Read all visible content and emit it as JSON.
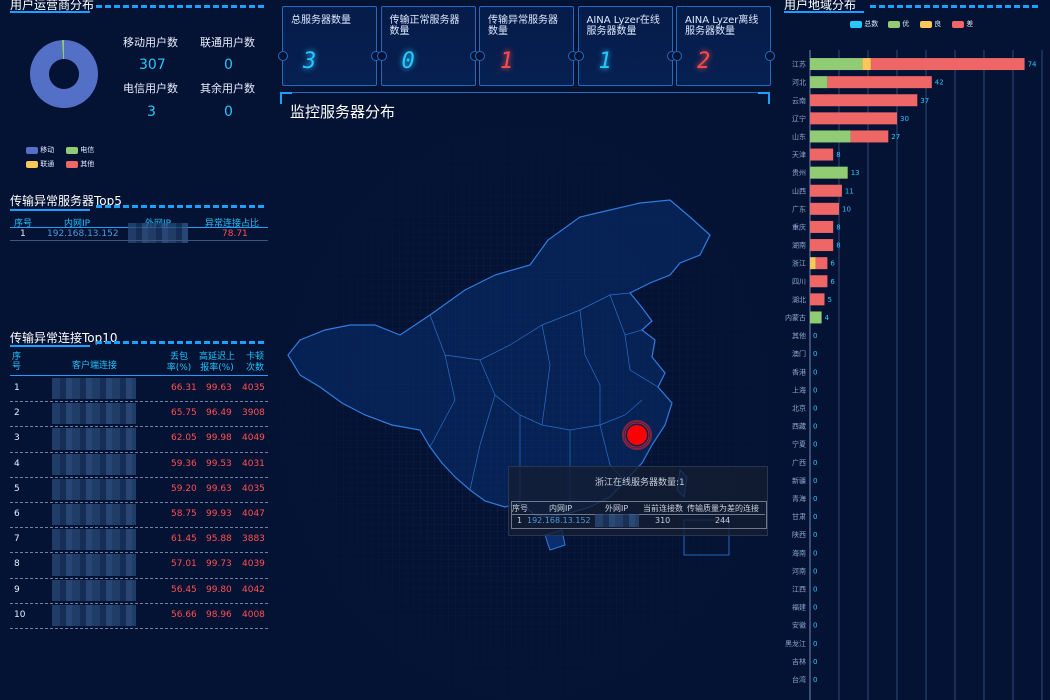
{
  "operator": {
    "title": "用户运营商分布",
    "stats": [
      {
        "label": "移动用户数",
        "value": "307"
      },
      {
        "label": "联通用户数",
        "value": "0"
      },
      {
        "label": "电信用户数",
        "value": "3"
      },
      {
        "label": "其余用户数",
        "value": "0"
      }
    ],
    "donut": [
      {
        "name": "移动",
        "value": 307,
        "color": "#5470c6"
      },
      {
        "name": "电信",
        "value": 3,
        "color": "#91cc75"
      },
      {
        "name": "联通",
        "value": 0,
        "color": "#fac858"
      },
      {
        "name": "其他",
        "value": 0,
        "color": "#ee6666"
      }
    ]
  },
  "top5": {
    "title": "传输异常服务器Top5",
    "headers": [
      "序号",
      "内网IP",
      "外网IP",
      "异常连接占比"
    ],
    "rows": [
      {
        "no": "1",
        "inner_ip": "192.168.13.152",
        "ratio": "78.71"
      }
    ]
  },
  "top10": {
    "title": "传输异常连接Top10",
    "headers": [
      "序号",
      "客户端连接",
      "丢包率(%)",
      "高延迟上报率(%)",
      "卡顿次数"
    ],
    "rows": [
      {
        "no": "1",
        "loss": "66.31",
        "delay": "99.63",
        "stall": "4035"
      },
      {
        "no": "2",
        "loss": "65.75",
        "delay": "96.49",
        "stall": "3908"
      },
      {
        "no": "3",
        "loss": "62.05",
        "delay": "99.98",
        "stall": "4049"
      },
      {
        "no": "4",
        "loss": "59.36",
        "delay": "99.53",
        "stall": "4031"
      },
      {
        "no": "5",
        "loss": "59.20",
        "delay": "99.63",
        "stall": "4035"
      },
      {
        "no": "6",
        "loss": "58.75",
        "delay": "99.93",
        "stall": "4047"
      },
      {
        "no": "7",
        "loss": "61.45",
        "delay": "95.88",
        "stall": "3883"
      },
      {
        "no": "8",
        "loss": "57.01",
        "delay": "99.73",
        "stall": "4039"
      },
      {
        "no": "9",
        "loss": "56.45",
        "delay": "99.80",
        "stall": "4042"
      },
      {
        "no": "10",
        "loss": "56.66",
        "delay": "98.96",
        "stall": "4008"
      }
    ]
  },
  "cards": [
    {
      "label": "总服务器数量",
      "value": "3",
      "color": "#26c9ff"
    },
    {
      "label": "传输正常服务器数量",
      "value": "0",
      "color": "#26c9ff"
    },
    {
      "label": "传输异常服务器数量",
      "value": "1",
      "color": "#ff4a4a"
    },
    {
      "label": "AINA Lyzer在线服务器数量",
      "value": "1",
      "color": "#26c9ff"
    },
    {
      "label": "AINA Lyzer离线服务器数量",
      "value": "2",
      "color": "#ff4a4a"
    }
  ],
  "map": {
    "title": "监控服务器分布",
    "marker_color": "#ff0000",
    "tooltip": {
      "title": "浙江在线服务器数量:1",
      "headers": [
        "序号",
        "内网IP",
        "外网IP",
        "当前连接数",
        "传输质量为差的连接"
      ],
      "row": {
        "no": "1",
        "inner_ip": "192.168.13.152",
        "current": "310",
        "poor": "244"
      }
    }
  },
  "region": {
    "title": "用户地域分布"
  },
  "chart_data": {
    "type": "bar",
    "orientation": "horizontal",
    "stacked": true,
    "legend": [
      "总数",
      "优",
      "良",
      "差"
    ],
    "legend_colors": [
      "#26c9ff",
      "#91cc75",
      "#fac858",
      "#ee6666"
    ],
    "legend_position": "top",
    "categories": [
      "江苏",
      "河北",
      "云南",
      "辽宁",
      "山东",
      "天津",
      "贵州",
      "山西",
      "广东",
      "重庆",
      "湖南",
      "浙江",
      "四川",
      "湖北",
      "内蒙古",
      "其他",
      "澳门",
      "香港",
      "上海",
      "北京",
      "西藏",
      "宁夏",
      "广西",
      "新疆",
      "青海",
      "甘肃",
      "陕西",
      "海南",
      "河南",
      "江西",
      "福建",
      "安徽",
      "黑龙江",
      "吉林",
      "台湾"
    ],
    "totals": [
      74,
      42,
      37,
      30,
      27,
      8,
      13,
      11,
      10,
      8,
      8,
      6,
      6,
      5,
      4,
      0,
      0,
      0,
      0,
      0,
      0,
      0,
      0,
      0,
      0,
      0,
      0,
      0,
      0,
      0,
      0,
      0,
      0,
      0,
      0
    ],
    "series": [
      {
        "name": "优",
        "values": [
          18,
          6,
          0,
          0,
          14,
          0,
          13,
          0,
          0,
          0,
          0,
          0,
          0,
          0,
          4,
          0,
          0,
          0,
          0,
          0,
          0,
          0,
          0,
          0,
          0,
          0,
          0,
          0,
          0,
          0,
          0,
          0,
          0,
          0,
          0
        ]
      },
      {
        "name": "良",
        "values": [
          3,
          0,
          0,
          0,
          0,
          0,
          0,
          0,
          0,
          0,
          0,
          2,
          0,
          0,
          0,
          0,
          0,
          0,
          0,
          0,
          0,
          0,
          0,
          0,
          0,
          0,
          0,
          0,
          0,
          0,
          0,
          0,
          0,
          0,
          0
        ]
      },
      {
        "name": "差",
        "values": [
          53,
          36,
          37,
          30,
          13,
          8,
          0,
          11,
          10,
          8,
          8,
          4,
          6,
          5,
          0,
          0,
          0,
          0,
          0,
          0,
          0,
          0,
          0,
          0,
          0,
          0,
          0,
          0,
          0,
          0,
          0,
          0,
          0,
          0,
          0
        ]
      }
    ],
    "xlim": [
      0,
      80
    ],
    "grid": true
  }
}
